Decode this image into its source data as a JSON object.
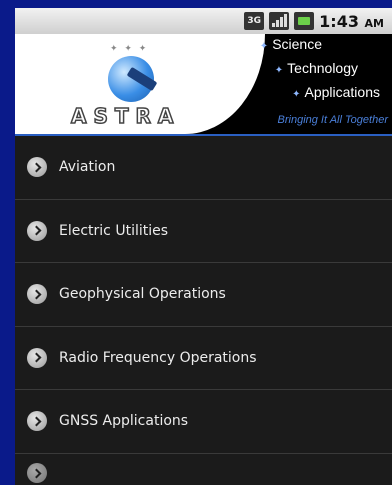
{
  "status_bar": {
    "network": "3G",
    "time": "1:43",
    "ampm": "AM"
  },
  "header": {
    "brand": "ASTRA",
    "taglines": [
      "Science",
      "Technology",
      "Applications"
    ],
    "slogan": "Bringing It All Together"
  },
  "menu": {
    "items": [
      {
        "label": "Aviation"
      },
      {
        "label": "Electric Utilities"
      },
      {
        "label": "Geophysical Operations"
      },
      {
        "label": "Radio Frequency Operations"
      },
      {
        "label": "GNSS Applications"
      }
    ]
  },
  "colors": {
    "background": "#0a1a8a",
    "list_bg": "#1b1b1b",
    "accent": "#2a5fc2"
  }
}
